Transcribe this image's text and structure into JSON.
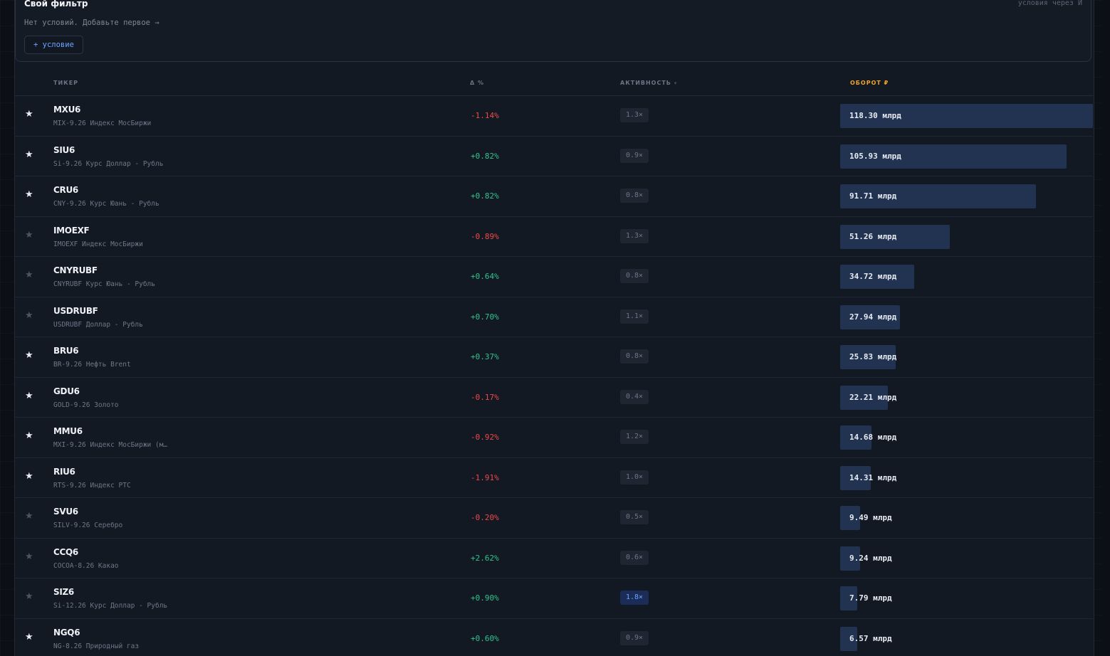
{
  "filter": {
    "title": "Свой фильтр",
    "hint": "условия через И",
    "empty_text": "Нет условий. Добавьте первое →",
    "add_label": "+ условие"
  },
  "columns": {
    "ticker": "ТИКЕР",
    "change": "Δ %",
    "activity": "АКТИВНОСТЬ",
    "activity_sort": "▾",
    "turnover": "ОБОРОТ ₽"
  },
  "colors": {
    "positive": "#31c48d",
    "negative": "#ec4a4a",
    "accent": "#f0a32a",
    "bar": "#223352"
  },
  "rows": [
    {
      "starred": true,
      "ticker": "MXU6",
      "name": "MIX-9.26 Индекс МосБиржи",
      "change": "-1.14%",
      "activity": "1.3×",
      "turnover": "118.30 млрд",
      "turnover_value": 118.3
    },
    {
      "starred": true,
      "ticker": "SIU6",
      "name": "Si-9.26 Курс Доллар - Рубль",
      "change": "+0.82%",
      "activity": "0.9×",
      "turnover": "105.93 млрд",
      "turnover_value": 105.93
    },
    {
      "starred": true,
      "ticker": "CRU6",
      "name": "CNY-9.26 Курс Юань - Рубль",
      "change": "+0.82%",
      "activity": "0.8×",
      "turnover": "91.71 млрд",
      "turnover_value": 91.71
    },
    {
      "starred": false,
      "ticker": "IMOEXF",
      "name": "IMOEXF Индекс МосБиржи",
      "change": "-0.89%",
      "activity": "1.3×",
      "turnover": "51.26 млрд",
      "turnover_value": 51.26
    },
    {
      "starred": false,
      "ticker": "CNYRUBF",
      "name": "CNYRUBF Курс Юань - Рубль",
      "change": "+0.64%",
      "activity": "0.8×",
      "turnover": "34.72 млрд",
      "turnover_value": 34.72
    },
    {
      "starred": false,
      "ticker": "USDRUBF",
      "name": "USDRUBF Доллар - Рубль",
      "change": "+0.70%",
      "activity": "1.1×",
      "turnover": "27.94 млрд",
      "turnover_value": 27.94
    },
    {
      "starred": true,
      "ticker": "BRU6",
      "name": "BR-9.26 Нефть Brent",
      "change": "+0.37%",
      "activity": "0.8×",
      "turnover": "25.83 млрд",
      "turnover_value": 25.83
    },
    {
      "starred": true,
      "ticker": "GDU6",
      "name": "GOLD-9.26 Золото",
      "change": "-0.17%",
      "activity": "0.4×",
      "turnover": "22.21 млрд",
      "turnover_value": 22.21
    },
    {
      "starred": true,
      "ticker": "MMU6",
      "name": "MXI-9.26 Индекс МосБиржи (м…",
      "change": "-0.92%",
      "activity": "1.2×",
      "turnover": "14.68 млрд",
      "turnover_value": 14.68
    },
    {
      "starred": true,
      "ticker": "RIU6",
      "name": "RTS-9.26 Индекс РТС",
      "change": "-1.91%",
      "activity": "1.0×",
      "turnover": "14.31 млрд",
      "turnover_value": 14.31
    },
    {
      "starred": false,
      "ticker": "SVU6",
      "name": "SILV-9.26 Серебро",
      "change": "-0.20%",
      "activity": "0.5×",
      "turnover": "9.49 млрд",
      "turnover_value": 9.49
    },
    {
      "starred": false,
      "ticker": "CCQ6",
      "name": "COCOA-8.26 Какао",
      "change": "+2.62%",
      "activity": "0.6×",
      "turnover": "9.24 млрд",
      "turnover_value": 9.24
    },
    {
      "starred": false,
      "ticker": "SIZ6",
      "name": "Si-12.26 Курс Доллар - Рубль",
      "change": "+0.90%",
      "activity": "1.8×",
      "turnover": "7.79 млрд",
      "turnover_value": 7.79
    },
    {
      "starred": true,
      "ticker": "NGQ6",
      "name": "NG-8.26 Природный газ",
      "change": "+0.60%",
      "activity": "0.9×",
      "turnover": "6.57 млрд",
      "turnover_value": 6.57
    }
  ]
}
